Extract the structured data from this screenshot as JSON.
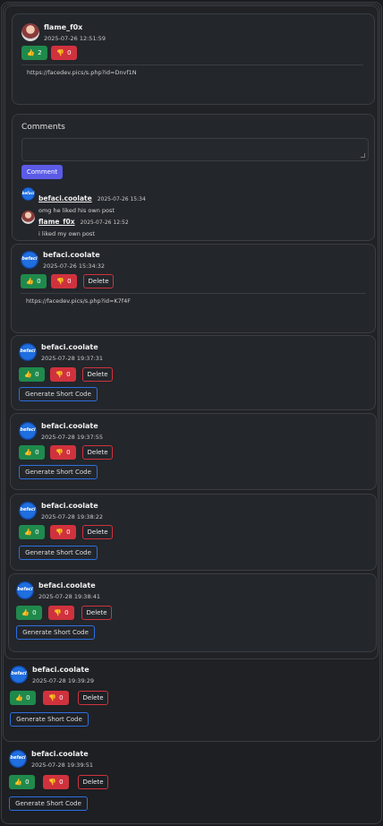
{
  "posts": [
    {
      "user": "flame_f0x",
      "date": "2025-07-26 12:51:59",
      "likes": "2",
      "dislikes": "0",
      "link": "https://facedev.pics/s.php?id=Dnvf1N",
      "avatar": "flame"
    },
    {
      "user": "befaci.coolate",
      "date": "2025-07-26 15:34:32",
      "likes": "0",
      "dislikes": "0",
      "link": "https://facedev.pics/s.php?id=K7f4F",
      "delete": "Delete",
      "avatar": "bef"
    },
    {
      "user": "befaci.coolate",
      "date": "2025-07-28 19:37:31",
      "likes": "0",
      "dislikes": "0",
      "delete": "Delete",
      "gen": "Generate Short Code",
      "avatar": "bef"
    },
    {
      "user": "befaci.coolate",
      "date": "2025-07-28 19:37:55",
      "likes": "0",
      "dislikes": "0",
      "delete": "Delete",
      "gen": "Generate Short Code",
      "avatar": "bef"
    },
    {
      "user": "befaci.coolate",
      "date": "2025-07-28 19:38:22",
      "likes": "0",
      "dislikes": "0",
      "delete": "Delete",
      "gen": "Generate Short Code",
      "avatar": "bef"
    },
    {
      "user": "befaci.coolate",
      "date": "2025-07-28 19:38:41",
      "likes": "0",
      "dislikes": "0",
      "delete": "Delete",
      "gen": "Generate Short Code",
      "avatar": "bef"
    },
    {
      "user": "befaci.coolate",
      "date": "2025-07-28 19:39:29",
      "likes": "0",
      "dislikes": "0",
      "delete": "Delete",
      "gen": "Generate Short Code",
      "avatar": "bef"
    },
    {
      "user": "befaci.coolate",
      "date": "2025-07-28 19:39:51",
      "likes": "0",
      "dislikes": "0",
      "delete": "Delete",
      "gen": "Generate Short Code",
      "avatar": "bef"
    }
  ],
  "comments_section": {
    "title": "Comments",
    "button": "Comment",
    "items": [
      {
        "user": "befaci.coolate",
        "date": "2025-07-26 15:34",
        "text": "omg he liked his own post",
        "avatar": "bef"
      },
      {
        "user": "flame_f0x",
        "date": "2025-07-26 12:52",
        "text": "i liked my own post",
        "avatar": "flame"
      }
    ]
  },
  "avatar_text": "befaci",
  "icons": {
    "like": "thumbs-up-icon",
    "dislike": "thumbs-down-icon"
  },
  "colors": {
    "like": "#1f8a4c",
    "dislike": "#d0323d",
    "gen": "#2e6fe0",
    "comment_btn": "#5b5be8"
  }
}
